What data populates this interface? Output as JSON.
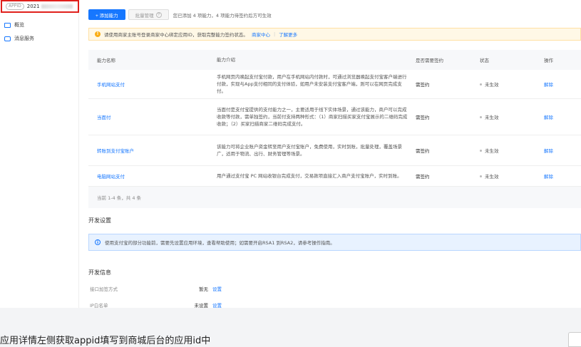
{
  "sidebar": {
    "app_tag": "APPID",
    "app_id_prefix": "2021",
    "items": [
      {
        "label": "概览",
        "icon": "monitor-icon"
      },
      {
        "label": "消息服务",
        "icon": "message-icon"
      }
    ]
  },
  "toolbar": {
    "add_label": "+ 添加能力",
    "batch_label": "批量管理",
    "hint": "您已添加 4 项能力，4 项能力待签约后方可生效"
  },
  "notice": {
    "text": "请使用商家主账号登录商家中心绑定应用ID，获取完整能力签约状态。",
    "link1": "商家中心",
    "link2": "了解更多"
  },
  "table": {
    "headers": [
      "能力名称",
      "能力介绍",
      "是否需要签约",
      "状态",
      "操作"
    ],
    "rows": [
      {
        "name": "手机网站支付",
        "desc": "手机网页内唤起支付宝付款，用户在手机网站内付款时，可通过浏览器唤起支付宝客户端进行付款，实现与App支付相同的支付体验，如用户未安装支付宝客户端，则可以在网页完成支付。",
        "sign": "需签约",
        "status": "未生效",
        "action": "解除"
      },
      {
        "name": "当面付",
        "desc": "当面付是支付宝提供的支付能力之一，主要适用于线下实体场景，通过该能力，商户可以完成收款等付款，需单独签约，当前付支持两种形式：（1）商家扫描买家支付宝展示的二维码完成收款；（2）买家扫描商家二维码完成支付。",
        "sign": "需签约",
        "status": "未生效",
        "action": "解除"
      },
      {
        "name": "转账到支付宝账户",
        "desc": "该能力可将企业账户资金转至用户支付宝账户，免费使用，实时到账，批量处理，覆盖场景广，适用于物流、出行、财务管理等场景。",
        "sign": "需签约",
        "status": "未生效",
        "action": "解除"
      },
      {
        "name": "电脑网站支付",
        "desc": "用户通过支付宝 PC 网站收银台完成支付，交易款项直接汇入商户支付宝账户，实时到账。",
        "sign": "需签约",
        "status": "未生效",
        "action": "解除"
      }
    ],
    "footer": "当前 1-4 条，共 4 条"
  },
  "dev_settings": {
    "title": "开发设置",
    "info": "使用支付宝的部分功能前，需要先设置应用环境，查看帮助使用；如需要开启RSA1 到RSA2，请参考操作指南。"
  },
  "dev_info": {
    "title": "开发信息",
    "items": [
      {
        "key": "接口加签方式",
        "value": "暂无",
        "action": "设置"
      },
      {
        "key": "IP白名单",
        "value": "未设置",
        "action": "设置"
      }
    ]
  },
  "caption": "应用详情左侧获取appid填写到商城后台的应用id中"
}
